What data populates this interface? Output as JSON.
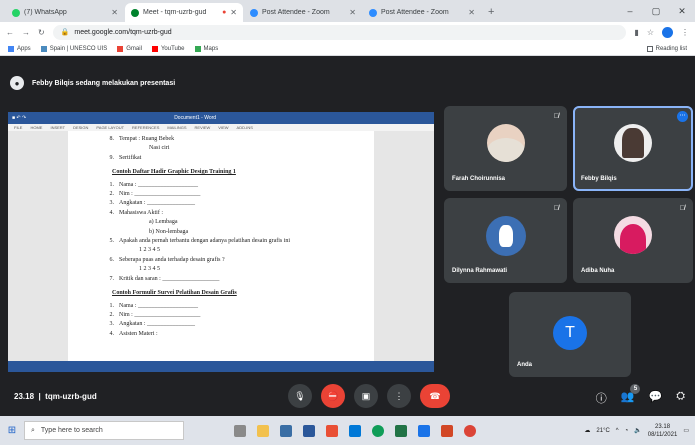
{
  "browser": {
    "tabs": [
      {
        "title": "(7) WhatsApp",
        "color": "#25d366"
      },
      {
        "title": "Meet - tqm-uzrb-gud",
        "color": "#00832d",
        "recording": true
      },
      {
        "title": "Post Attendee - Zoom",
        "color": "#2d8cff"
      },
      {
        "title": "Post Attendee - Zoom",
        "color": "#2d8cff"
      }
    ],
    "new_tab": "+",
    "url": "meet.google.com/tqm-uzrb-gud",
    "bookmarks": [
      "Apps",
      "Spain | UNESCO UIS",
      "Gmail",
      "YouTube",
      "Maps"
    ],
    "reading_list": "Reading list"
  },
  "meet": {
    "presenting_text": "Febby Bilqis sedang melakukan presentasi",
    "meeting_time": "23.18",
    "meeting_code": "tqm-uzrb-gud",
    "participants": [
      {
        "name": "Farah Choirunnisa",
        "muted": true,
        "type": "photo",
        "bg": "#2f6b63"
      },
      {
        "name": "Febby Bilqis",
        "muted": false,
        "type": "photo",
        "bg": "#5a4a44",
        "active": true
      },
      {
        "name": "Dilynna Rahmawati",
        "muted": true,
        "type": "avatar",
        "bg": "#3c6fb4"
      },
      {
        "name": "Adiba Nuha",
        "muted": true,
        "type": "photo",
        "bg": "#c2185b"
      },
      {
        "name": "Anda",
        "muted": false,
        "type": "letter",
        "letter": "T",
        "bg": "#1a73e8"
      }
    ],
    "people_count": "5"
  },
  "document": {
    "header_title": "Document1 - Word",
    "ribbon_tabs": [
      "FILE",
      "HOME",
      "INSERT",
      "DESIGN",
      "PAGE LAYOUT",
      "REFERENCES",
      "MAILINGS",
      "REVIEW",
      "VIEW",
      "ADD-INS"
    ],
    "lines_top": [
      {
        "n": "8.",
        "t": "Tempat : Ruang Bebek"
      },
      {
        "n": "",
        "t": "Nasi ciri",
        "sub": true
      },
      {
        "n": "9.",
        "t": "Sertifikat"
      }
    ],
    "heading1": "Contoh Daftar Hadir Graphic Design Training 1",
    "list1": [
      {
        "n": "1.",
        "t": "Nama : ____________________"
      },
      {
        "n": "2.",
        "t": "Nim : ______________________"
      },
      {
        "n": "3.",
        "t": "Angkatan : ________________"
      },
      {
        "n": "4.",
        "t": "Mahasiswa Aktif :"
      },
      {
        "n": "",
        "t": "a) Lembaga",
        "sub": true
      },
      {
        "n": "",
        "t": "b) Non-lembaga",
        "sub": true
      },
      {
        "n": "5.",
        "t": "Apakah anda pernah terbantu dengan adanya pelatihan desain grafis ini"
      },
      {
        "n": "",
        "t": "1 2 3 4 5",
        "ind": true
      },
      {
        "n": "6.",
        "t": "Seberapa puas anda terhadap desain grafis ?"
      },
      {
        "n": "",
        "t": "1 2 3 4 5",
        "ind": true
      },
      {
        "n": "7.",
        "t": "Kritik dan saran : ___________________"
      }
    ],
    "heading2": "Contoh Formulir Survei Pelatihan Desain Grafis",
    "list2": [
      {
        "n": "1.",
        "t": "Nama : ____________________"
      },
      {
        "n": "2.",
        "t": "Nim : ______________________"
      },
      {
        "n": "3.",
        "t": "Angkatan : ________________"
      },
      {
        "n": "4.",
        "t": "Asisten Materi :"
      }
    ]
  },
  "taskbar": {
    "search_placeholder": "Type here to search",
    "weather": "21°C",
    "time": "23.18",
    "date": "08/11/2021"
  }
}
